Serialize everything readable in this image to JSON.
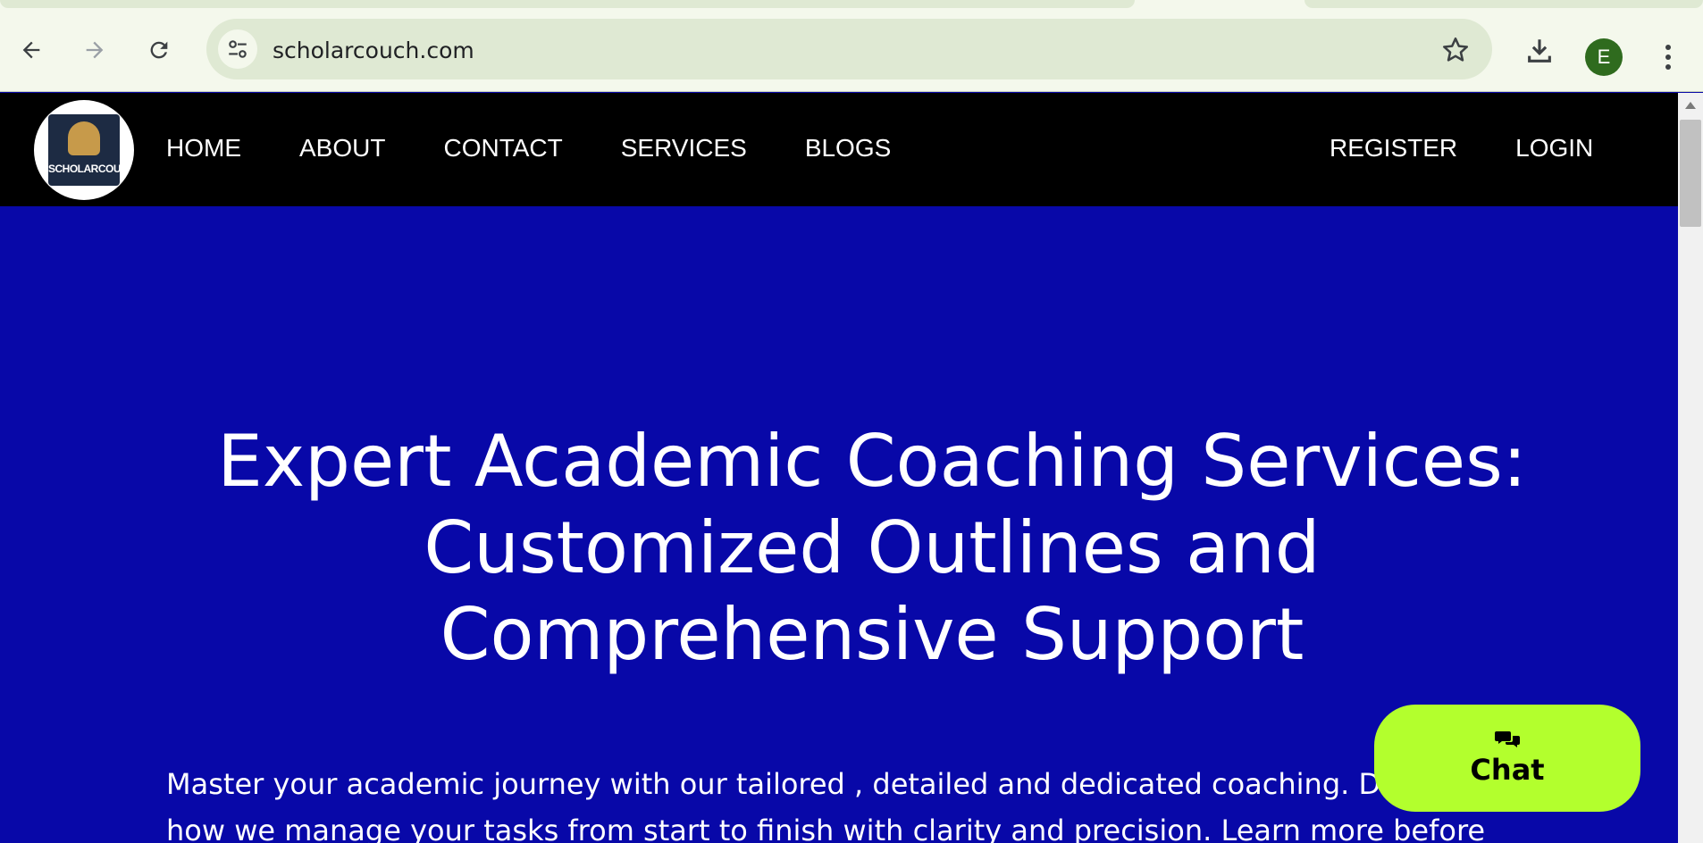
{
  "browser": {
    "url": "scholarcouch.com",
    "profile_initial": "E",
    "icons": {
      "back": "arrow-left-icon",
      "forward": "arrow-right-icon",
      "reload": "reload-icon",
      "site_info": "tune-icon",
      "bookmark": "star-icon",
      "download": "download-icon",
      "menu": "kebab-menu-icon"
    }
  },
  "header": {
    "logo_text": "SCHOLARCOUCH",
    "nav_left": [
      "HOME",
      "ABOUT",
      "CONTACT",
      "SERVICES",
      "BLOGS"
    ],
    "nav_right": [
      "REGISTER",
      "LOGIN"
    ]
  },
  "hero": {
    "title": "Expert Academic Coaching Services: Customized Outlines and Comprehensive Support",
    "text": "Master your academic journey with our tailored , detailed and dedicated coaching. Discover how we manage your tasks from start to finish with clarity and precision. Learn more before"
  },
  "chat": {
    "label": "Chat",
    "icon": "chat-bubbles-icon"
  },
  "colors": {
    "hero_bg": "#0808a8",
    "header_bg": "#000000",
    "chat_bg": "#b3ff2d",
    "chrome_bg": "#f4f8ec",
    "omnibox_bg": "#dfe9d3",
    "avatar_bg": "#2f6b1e"
  }
}
